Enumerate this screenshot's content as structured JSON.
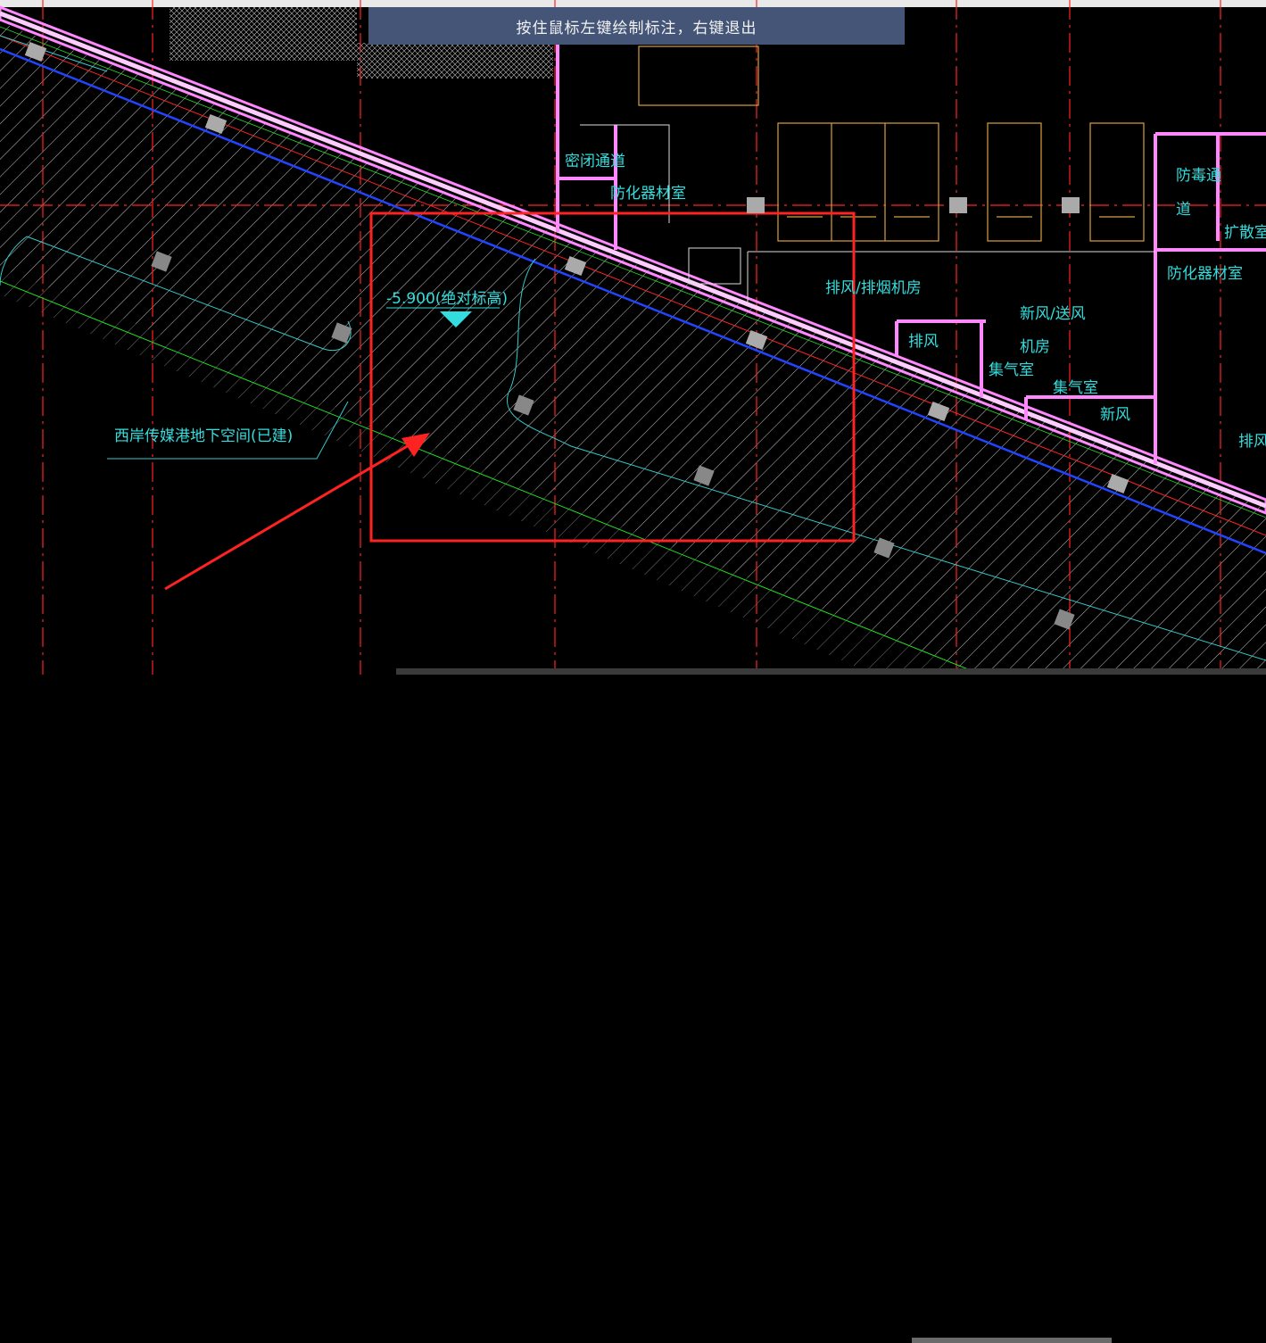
{
  "tooltip": {
    "text": "按住鼠标左键绘制标注，右键退出"
  },
  "annotation": {
    "elevation": "-5.900(绝对标高)"
  },
  "labels": {
    "airlock": "密闭通道",
    "chem_room_top": "防化器材室",
    "exhaust_room": "排风/排烟机房",
    "decon_path_1": "防毒通",
    "decon_path_2": "道",
    "expansion_room": "扩散室",
    "chem_room_right": "防化器材室",
    "fresh_air_room_1": "新风/送风",
    "fresh_air_room_2": "机房",
    "exhaust_small": "排风",
    "collector_1": "集气室",
    "collector_2": "集气室",
    "fresh_air": "新风",
    "exhaust_edge": "排风",
    "existing_space": "西岸传媒港地下空间(已建)"
  },
  "colors": {
    "background": "#000000",
    "hatch": "#ffffff",
    "wall": "#ff88ff",
    "axis": "#ff2222",
    "blue_line": "#2244ff",
    "cyan_line": "#33cccc",
    "green_line": "#22dd22",
    "text_cyan": "#33dddd",
    "marker_red": "#ff2222",
    "tooltip_bg": "#445577"
  }
}
